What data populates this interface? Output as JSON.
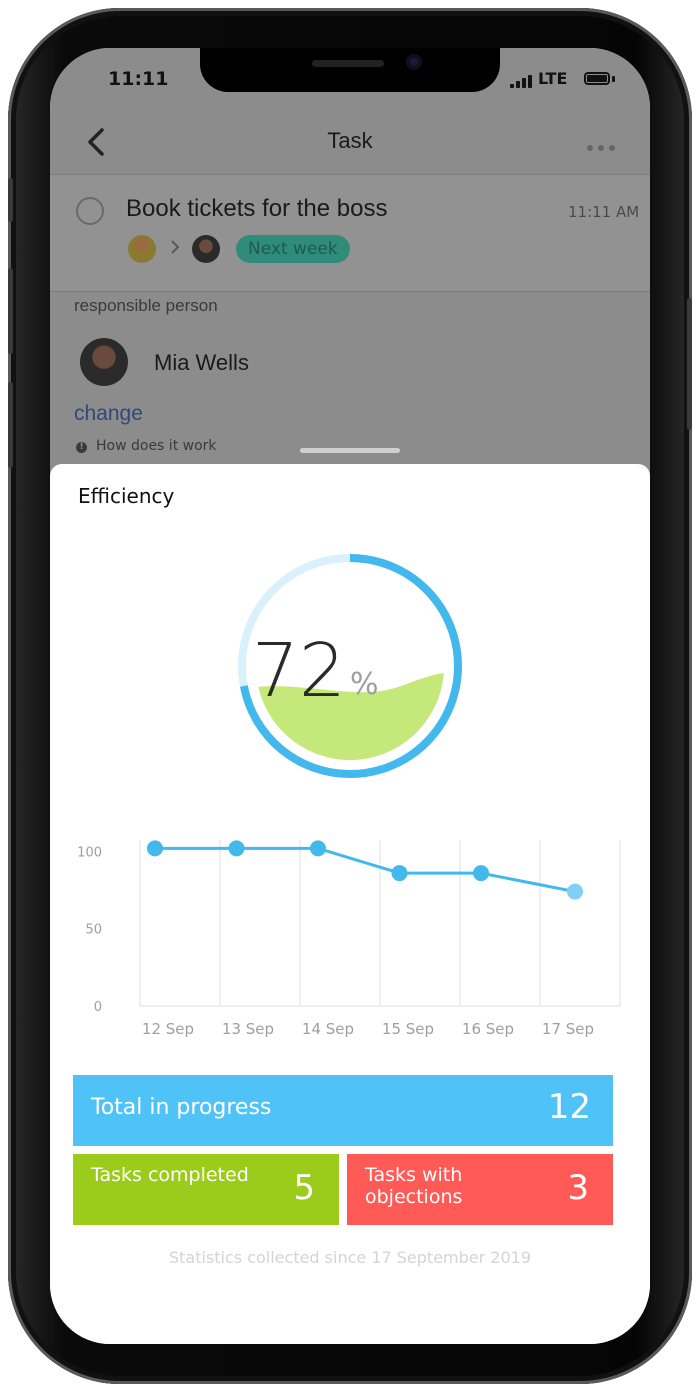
{
  "status_bar": {
    "time": "11:11",
    "network": "LTE"
  },
  "nav": {
    "title": "Task",
    "back_icon": "chevron-left-icon",
    "more_icon": "more-horizontal-icon"
  },
  "task": {
    "title": "Book tickets for the boss",
    "time": "11:11 AM",
    "badge": "Next week"
  },
  "responsible": {
    "label": "responsible person",
    "name": "Mia Wells",
    "change_label": "change",
    "how_label": "How does it work"
  },
  "efficiency": {
    "title": "Efficiency",
    "percent": 72,
    "percent_suffix": "%",
    "colors": {
      "ring": "#42b8ec",
      "ring_light": "#d9f1fc",
      "fill": "#c5e87a"
    }
  },
  "chart_data": {
    "type": "line",
    "categories": [
      "12 Sep",
      "13 Sep",
      "14 Sep",
      "15 Sep",
      "16 Sep",
      "17 Sep"
    ],
    "values": [
      102,
      102,
      102,
      86,
      86,
      74
    ],
    "yticks": [
      0,
      50,
      100
    ],
    "ylim": [
      0,
      110
    ],
    "grid": "vertical",
    "color": "#42b8ec",
    "title": "",
    "xlabel": "",
    "ylabel": ""
  },
  "stats": {
    "total_label": "Total in progress",
    "total_value": "12",
    "completed_label": "Tasks completed",
    "completed_value": "5",
    "objections_label": "Tasks with objections",
    "objections_value": "3",
    "footer": "Statistics collected since 17 September 2019"
  }
}
